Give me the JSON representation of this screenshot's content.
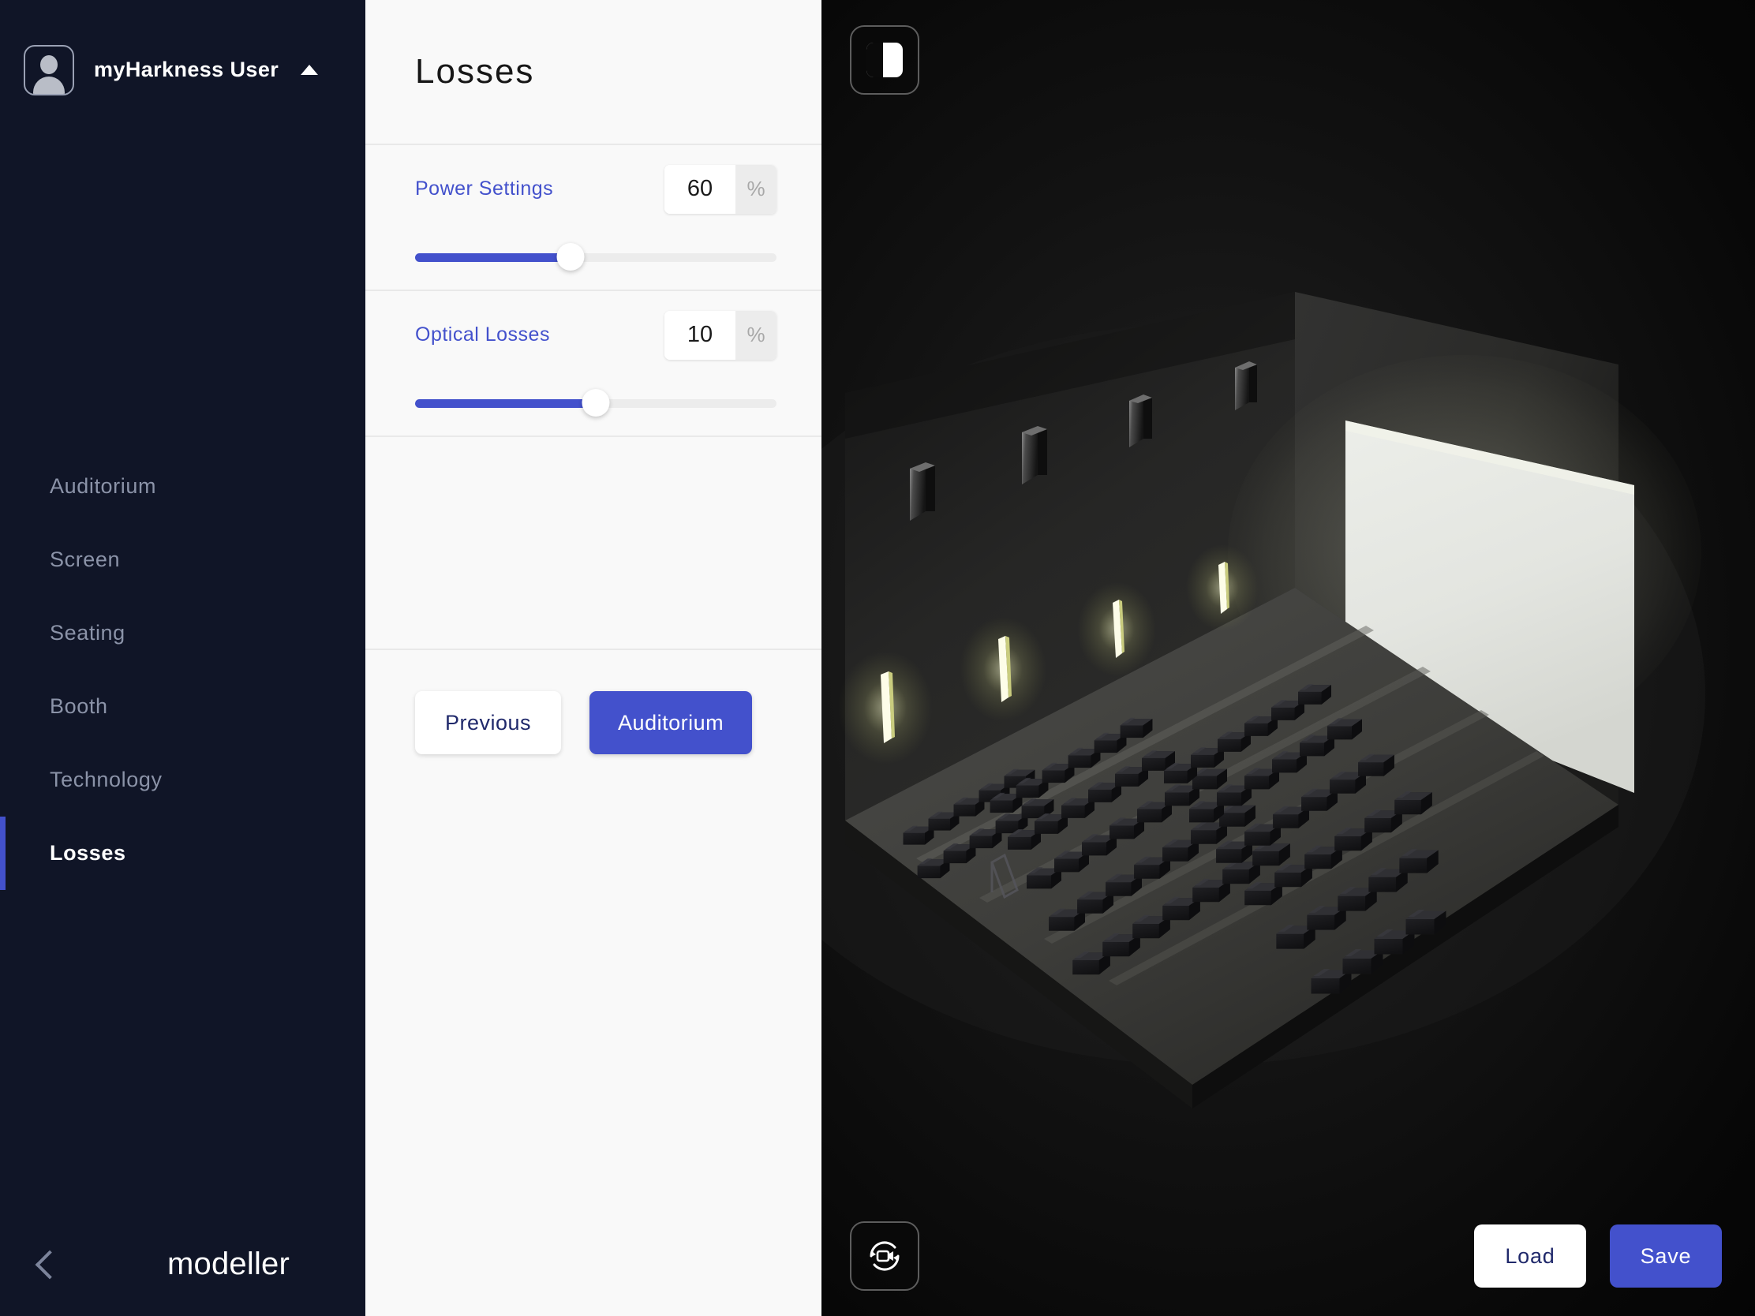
{
  "sidebar": {
    "user": {
      "name": "myHarkness User",
      "avatar_icon": "user-avatar-icon",
      "caret_icon": "caret-up-icon"
    },
    "items": [
      {
        "label": "Auditorium",
        "active": false
      },
      {
        "label": "Screen",
        "active": false
      },
      {
        "label": "Seating",
        "active": false
      },
      {
        "label": "Booth",
        "active": false
      },
      {
        "label": "Technology",
        "active": false
      },
      {
        "label": "Losses",
        "active": true
      }
    ],
    "brand": {
      "back_icon": "chevron-left-icon",
      "logo_icon": "modeller-spectrum-logo",
      "name": "modeller"
    },
    "colors": {
      "background": "#101527",
      "active_indicator": "#4351cc",
      "active_text": "#ffffff",
      "inactive_text": "#8b93a8"
    }
  },
  "panel": {
    "title": "Losses",
    "fields": [
      {
        "label": "Power Settings",
        "value": "60",
        "unit": "%",
        "placeholder": "0",
        "slider_percent": 43
      },
      {
        "label": "Optical Losses",
        "value": "10",
        "unit": "%",
        "placeholder": "0",
        "slider_percent": 50
      }
    ],
    "buttons": {
      "previous": "Previous",
      "next": "Auditorium"
    },
    "colors": {
      "background": "#f9f9f9",
      "label": "#4351cc",
      "accent": "#4351cc",
      "divider": "#e9e9e9"
    }
  },
  "viewport": {
    "panel_toggle_icon": "panel-toggle-icon",
    "camera_reset_icon": "camera-reset-icon",
    "load_label": "Load",
    "save_label": "Save",
    "scene": {
      "description": "3D auditorium render",
      "screen_color": "#e6e7e2",
      "seat_rows": 12,
      "light_fixtures": 4,
      "wall_speakers": 4
    }
  }
}
